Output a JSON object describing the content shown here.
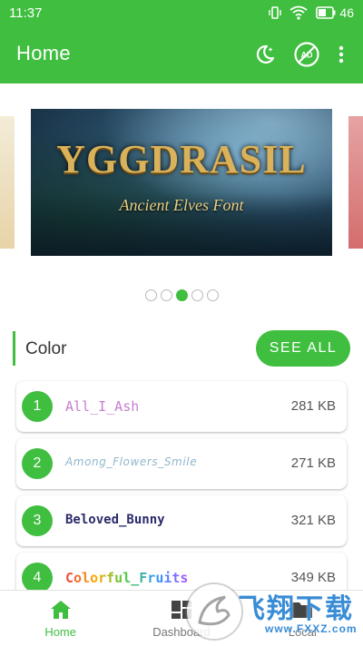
{
  "status_bar": {
    "time": "11:37",
    "battery_level": "46",
    "icons": [
      "vibrate-icon",
      "wifi-icon",
      "battery-icon"
    ]
  },
  "app_bar": {
    "title": "Home",
    "actions": [
      "night-mode-icon",
      "ad-free-icon",
      "more-vert-icon"
    ]
  },
  "banner": {
    "title": "YGGDRASIL",
    "subtitle": "Ancient Elves Font",
    "dot_count": 5,
    "active_dot": 2
  },
  "section": {
    "title": "Color",
    "see_all_label": "SEE ALL"
  },
  "fonts": [
    {
      "index": "1",
      "name": "All_I_Ash",
      "size": "281 KB"
    },
    {
      "index": "2",
      "name": "Among_Flowers_Smile",
      "size": "271 KB"
    },
    {
      "index": "3",
      "name": "Beloved_Bunny",
      "size": "321 KB"
    },
    {
      "index": "4",
      "name": "Colorful_Fruits",
      "size": "349 KB"
    }
  ],
  "bottom_nav": {
    "items": [
      {
        "label": "Home",
        "icon": "home-icon",
        "active": true
      },
      {
        "label": "Dashboard",
        "icon": "dashboard-icon",
        "active": false
      },
      {
        "label": "Local",
        "icon": "folder-icon",
        "active": false
      }
    ]
  },
  "watermark": {
    "text": "飞翔下载",
    "url": "www.FXXZ.com"
  },
  "colors": {
    "accent": "#3fbe3f",
    "banner_gold": "#d9b25b"
  }
}
